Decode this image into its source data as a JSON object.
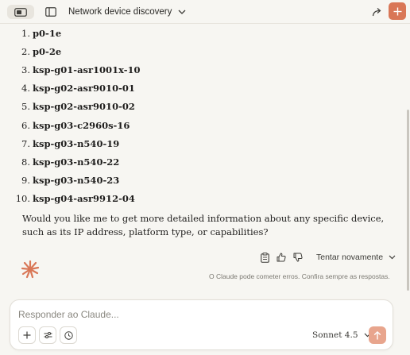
{
  "header": {
    "title": "Network device discovery"
  },
  "devices": [
    {
      "num": "1.",
      "name": "p0-1e"
    },
    {
      "num": "2.",
      "name": "p0-2e"
    },
    {
      "num": "3.",
      "name": "ksp-g01-asr1001x-10"
    },
    {
      "num": "4.",
      "name": "ksp-g02-asr9010-01"
    },
    {
      "num": "5.",
      "name": "ksp-g02-asr9010-02"
    },
    {
      "num": "6.",
      "name": "ksp-g03-c2960s-16"
    },
    {
      "num": "7.",
      "name": "ksp-g03-n540-19"
    },
    {
      "num": "8.",
      "name": "ksp-g03-n540-22"
    },
    {
      "num": "9.",
      "name": "ksp-g03-n540-23"
    },
    {
      "num": "10.",
      "name": "ksp-g04-asr9912-04"
    }
  ],
  "followup": "Would you like me to get more detailed information about any specific device, such as its IP address, platform type, or capabilities?",
  "actions": {
    "retry_label": "Tentar novamente"
  },
  "disclaimer": "O Claude pode cometer erros. Confira sempre as respostas.",
  "composer": {
    "placeholder": "Responder ao Claude...",
    "model_label": "Sonnet 4.5"
  },
  "colors": {
    "accent": "#d97757",
    "send_disabled": "#e8a58d",
    "background": "#f7f6f2"
  },
  "icons": [
    "panel-icon",
    "sidebar-icon",
    "chevron-down-icon",
    "share-icon",
    "plus-icon",
    "copy-icon",
    "thumbs-up-icon",
    "thumbs-down-icon",
    "claude-spark-icon",
    "sliders-icon",
    "clock-icon",
    "arrow-up-icon"
  ]
}
